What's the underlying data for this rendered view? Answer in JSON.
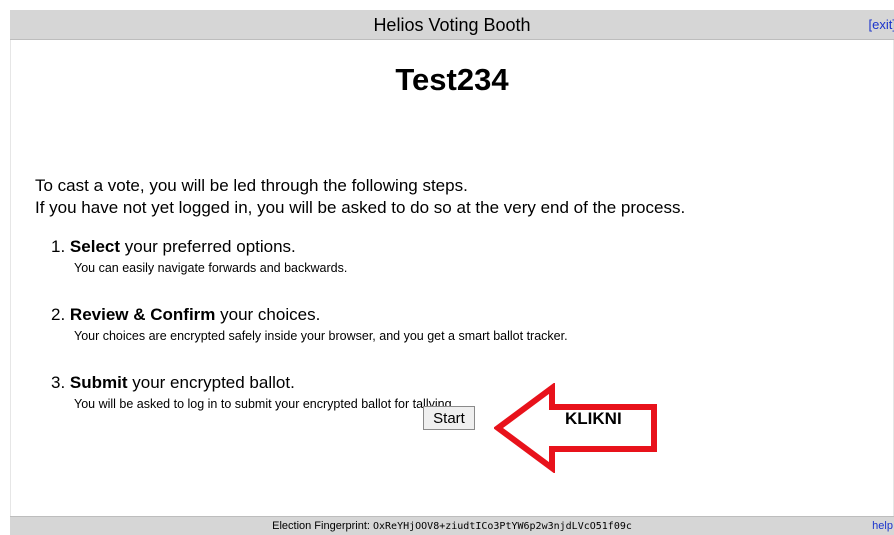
{
  "header": {
    "title": "Helios Voting Booth",
    "exit_link": "[exit]"
  },
  "election": {
    "name": "Test234"
  },
  "intro": {
    "line1": "To cast a vote, you will be led through the following steps.",
    "line2": "If you have not yet logged in, you will be asked to do so at the very end of the process."
  },
  "steps": [
    {
      "number": "1.",
      "bold": "Select",
      "rest": " your preferred options.",
      "detail": "You can easily navigate forwards and backwards."
    },
    {
      "number": "2.",
      "bold": "Review & Confirm",
      "rest": " your choices.",
      "detail": "Your choices are encrypted safely inside your browser, and you get a smart ballot tracker."
    },
    {
      "number": "3.",
      "bold": "Submit",
      "rest": " your encrypted ballot.",
      "detail": "You will be asked to log in to submit your encrypted ballot for tallying."
    }
  ],
  "start_button": {
    "label": "Start"
  },
  "annotation": {
    "label": "KLIKNI",
    "arrow_color": "#e8121b"
  },
  "footer": {
    "fingerprint_label": "Election Fingerprint:",
    "fingerprint_value": "OxReYHjOOV8+ziudtICo3PtYW6p2w3njdLVcO51f09c",
    "help_link": "help!"
  }
}
